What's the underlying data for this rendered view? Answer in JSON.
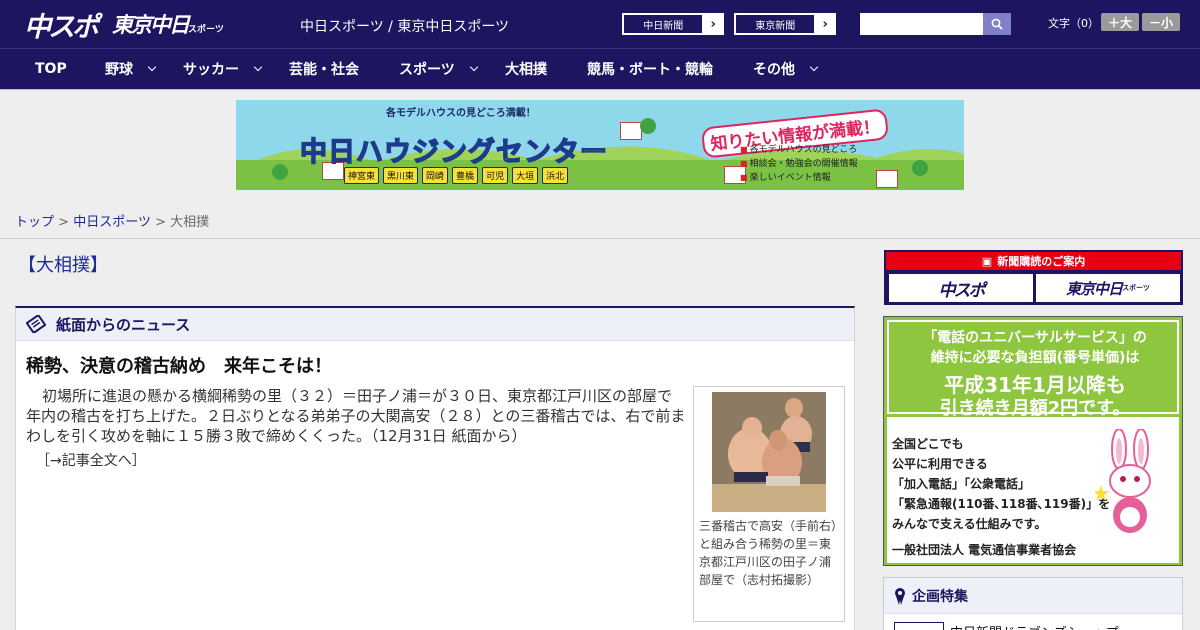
{
  "header": {
    "logo_chusupo": "中スポ",
    "logo_tokyo": "東京中日",
    "logo_tokyo_suffix": "スポーツ",
    "site_names": "中日スポーツ / 東京中日スポーツ",
    "chunichi_button": "中日新聞",
    "tokyo_button": "東京新聞",
    "search_value": "",
    "font_size_label": "文字（0）",
    "font_larger": "＋大",
    "font_smaller": "－小"
  },
  "nav": {
    "items": [
      {
        "label": "TOP"
      },
      {
        "label": "野球"
      },
      {
        "label": "サッカー"
      },
      {
        "label": "芸能・社会"
      },
      {
        "label": "スポーツ"
      },
      {
        "label": "大相撲"
      },
      {
        "label": "競馬・ボート・競輪"
      },
      {
        "label": "その他"
      }
    ]
  },
  "banner": {
    "top_text": "各モデルハウスの見どころ満載！",
    "title": "中日ハウジングセンター",
    "catch": "知りたい情報が満載！",
    "info": [
      "各モデルハウスの見どころ",
      "相談会・勉強会の開催情報",
      "楽しいイベント情報"
    ],
    "towns": [
      "神宮東",
      "黒川東",
      "岡崎",
      "豊橋",
      "可児",
      "大垣",
      "浜北"
    ]
  },
  "breadcrumb": {
    "home": "トップ",
    "section": "中日スポーツ",
    "current": "大相撲",
    "sep": ">"
  },
  "main": {
    "category_heading": "【大相撲】",
    "box_title": "紙面からのニュース",
    "article": {
      "title": "稀勢、決意の稽古納め　来年こそは！",
      "body": "初場所に進退の懸かる横綱稀勢の里（３２）＝田子ノ浦＝が３０日、東京都江戸川区の部屋で年内の稽古を打ち上げた。２日ぶりとなる弟弟子の大関高安（２８）との三番稽古では、右で前まわしを引く攻めを軸に１５勝３敗で締めくくった。（12月31日 紙面から）",
      "more": "［→記事全文へ］",
      "photo_caption": "三番稽古で高安（手前右）と組み合う稀勢の里＝東京都江戸川区の田子ノ浦部屋で（志村拓撮影）"
    }
  },
  "sidebar": {
    "subscribe_header": "新聞購読のご案内",
    "subscribe_chusupo": "中スポ",
    "subscribe_tokyo": "東京中日",
    "subscribe_tokyo_suffix": "スポーツ",
    "ad": {
      "line1": "「電話のユニバーサルサービス」の",
      "line2": "維持に必要な負担額(番号単価)は",
      "line3": "平成31年1月以降も",
      "line4": "引き続き月額2円です。",
      "body1": "全国どこでも",
      "body2": "公平に利用できる",
      "body3": "「加入電話」「公衆電話」",
      "body4": "「緊急通報(110番､118番､119番)」を",
      "body5": "みんなで支える仕組みです。",
      "org": "一般社団法人 電気通信事業者協会"
    },
    "feature_title": "企画特集",
    "feature_item": "中日新聞ドラゴンズショップ"
  },
  "colors": {
    "header_bg": "#1d1560",
    "link": "#1d2a9a",
    "ad_green": "#8ec63f",
    "subscribe_red": "#e60012"
  }
}
